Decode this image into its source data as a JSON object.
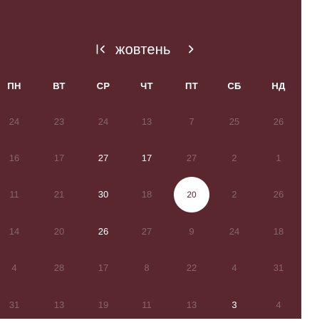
{
  "header": {
    "month": "жовтень",
    "prev_icon": "chevron-left-bar-icon",
    "next_icon": "chevron-right-icon"
  },
  "weekdays": [
    "ПН",
    "ВТ",
    "СР",
    "ЧТ",
    "ПТ",
    "СБ",
    "НД"
  ],
  "weeks": [
    [
      {
        "label": "24",
        "state": "muted"
      },
      {
        "label": "23",
        "state": "muted"
      },
      {
        "label": "24",
        "state": "muted"
      },
      {
        "label": "13",
        "state": "muted"
      },
      {
        "label": "7",
        "state": "muted"
      },
      {
        "label": "25",
        "state": "muted"
      },
      {
        "label": "26",
        "state": "muted"
      }
    ],
    [
      {
        "label": "16",
        "state": "muted"
      },
      {
        "label": "17",
        "state": "muted"
      },
      {
        "label": "27",
        "state": "active"
      },
      {
        "label": "17",
        "state": "active"
      },
      {
        "label": "27",
        "state": "muted"
      },
      {
        "label": "2",
        "state": "muted"
      },
      {
        "label": "1",
        "state": "muted"
      }
    ],
    [
      {
        "label": "11",
        "state": "muted"
      },
      {
        "label": "21",
        "state": "muted"
      },
      {
        "label": "30",
        "state": "active"
      },
      {
        "label": "18",
        "state": "muted"
      },
      {
        "label": "20",
        "state": "selected"
      },
      {
        "label": "2",
        "state": "muted"
      },
      {
        "label": "26",
        "state": "muted"
      }
    ],
    [
      {
        "label": "14",
        "state": "muted"
      },
      {
        "label": "20",
        "state": "muted"
      },
      {
        "label": "26",
        "state": "active"
      },
      {
        "label": "27",
        "state": "muted"
      },
      {
        "label": "9",
        "state": "muted"
      },
      {
        "label": "24",
        "state": "muted"
      },
      {
        "label": "18",
        "state": "muted"
      }
    ],
    [
      {
        "label": "4",
        "state": "muted"
      },
      {
        "label": "28",
        "state": "muted"
      },
      {
        "label": "17",
        "state": "muted"
      },
      {
        "label": "8",
        "state": "muted"
      },
      {
        "label": "22",
        "state": "muted"
      },
      {
        "label": "4",
        "state": "muted"
      },
      {
        "label": "31",
        "state": "muted"
      }
    ],
    [
      {
        "label": "31",
        "state": "muted"
      },
      {
        "label": "13",
        "state": "muted"
      },
      {
        "label": "19",
        "state": "muted"
      },
      {
        "label": "11",
        "state": "muted"
      },
      {
        "label": "13",
        "state": "muted"
      },
      {
        "label": "3",
        "state": "active"
      },
      {
        "label": "4",
        "state": "muted"
      }
    ]
  ],
  "colors": {
    "background": "#5a272f",
    "text": "#ffffff",
    "selected_fill": "#ffffff",
    "selected_text": "#5a272f"
  }
}
